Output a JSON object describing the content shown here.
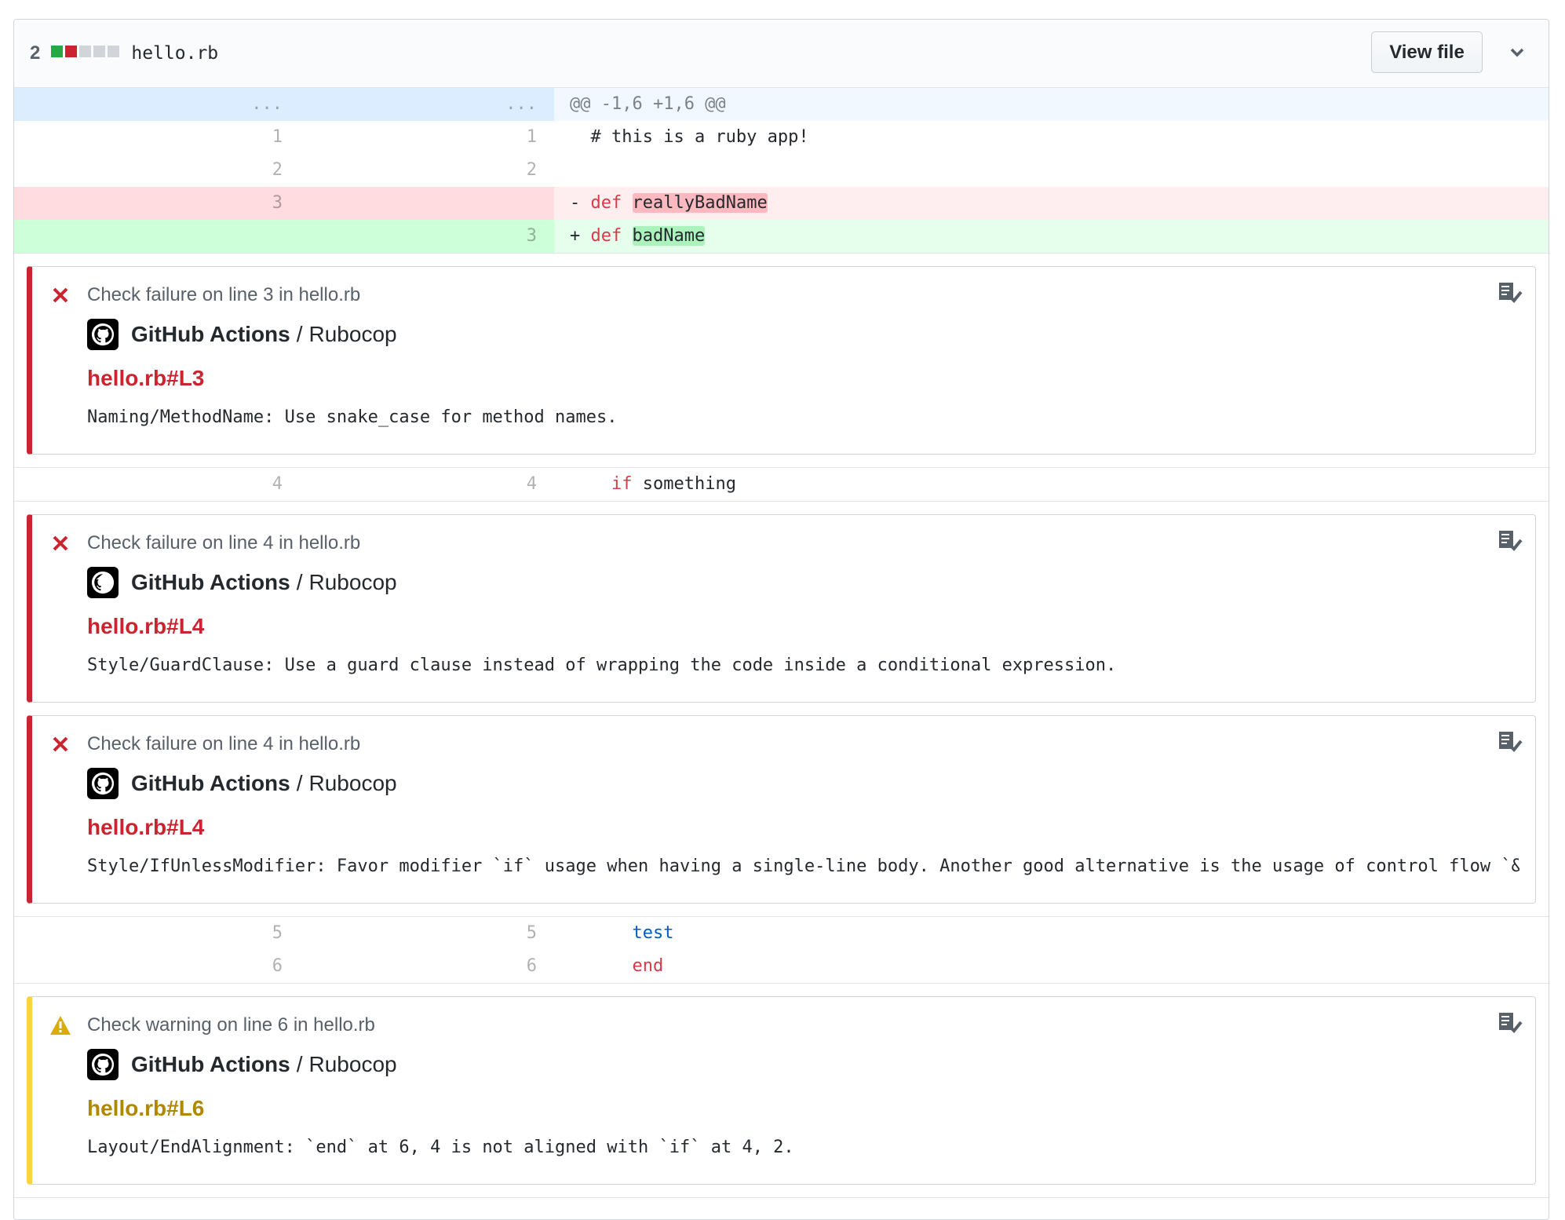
{
  "file": {
    "diffstat_count": "2",
    "diffstat_blocks": [
      "#28a745",
      "#cb2431",
      "#d1d5da",
      "#d1d5da",
      "#d1d5da"
    ],
    "name": "hello.rb",
    "view_file_label": "View file",
    "collapse_icon": "chevron-down-icon"
  },
  "diff": {
    "hunk_left": "...",
    "hunk_right": "...",
    "hunk_header": "@@ -1,6 +1,6 @@",
    "lines": [
      {
        "type": "context",
        "old": "1",
        "new": "1",
        "prefix": " ",
        "text": "# this is a ruby app!"
      },
      {
        "type": "context",
        "old": "2",
        "new": "2",
        "prefix": " ",
        "text": ""
      },
      {
        "type": "del",
        "old": "3",
        "new": "",
        "prefix": "-",
        "keyword": "def",
        "name": "reallyBadName"
      },
      {
        "type": "add",
        "old": "",
        "new": "3",
        "prefix": "+",
        "keyword": "def",
        "name": "badName"
      },
      {
        "type": "context",
        "old": "4",
        "new": "4",
        "prefix": " ",
        "keyword": "if",
        "text": "something"
      },
      {
        "type": "context",
        "old": "5",
        "new": "5",
        "prefix": " ",
        "text": "test"
      },
      {
        "type": "context",
        "old": "6",
        "new": "6",
        "prefix": " ",
        "keyword": "end"
      }
    ]
  },
  "annotations": [
    {
      "level": "failure",
      "title": "Check failure on line 3 in hello.rb",
      "app": "GitHub Actions",
      "separator": "/",
      "check": "Rubocop",
      "link": "hello.rb#L3",
      "message": "Naming/MethodName: Use snake_case for method names."
    },
    {
      "level": "failure",
      "title": "Check failure on line 4 in hello.rb",
      "app": "GitHub Actions",
      "separator": "/",
      "check": "Rubocop",
      "link": "hello.rb#L4",
      "message": "Style/GuardClause: Use a guard clause instead of wrapping the code inside a conditional expression."
    },
    {
      "level": "failure",
      "title": "Check failure on line 4 in hello.rb",
      "app": "GitHub Actions",
      "separator": "/",
      "check": "Rubocop",
      "link": "hello.rb#L4",
      "message": "Style/IfUnlessModifier: Favor modifier `if` usage when having a single-line body. Another good alternative is the usage of control flow `&&`/`||`."
    },
    {
      "level": "warning",
      "title": "Check warning on line 6 in hello.rb",
      "app": "GitHub Actions",
      "separator": "/",
      "check": "Rubocop",
      "link": "hello.rb#L6",
      "message": "Layout/EndAlignment: `end` at 6, 4 is not aligned with `if` at 4, 2."
    }
  ],
  "colors": {
    "failure": "#cb2431",
    "warning": "#ffd33d",
    "warning_link": "#b08800",
    "addition": "#28a745"
  }
}
